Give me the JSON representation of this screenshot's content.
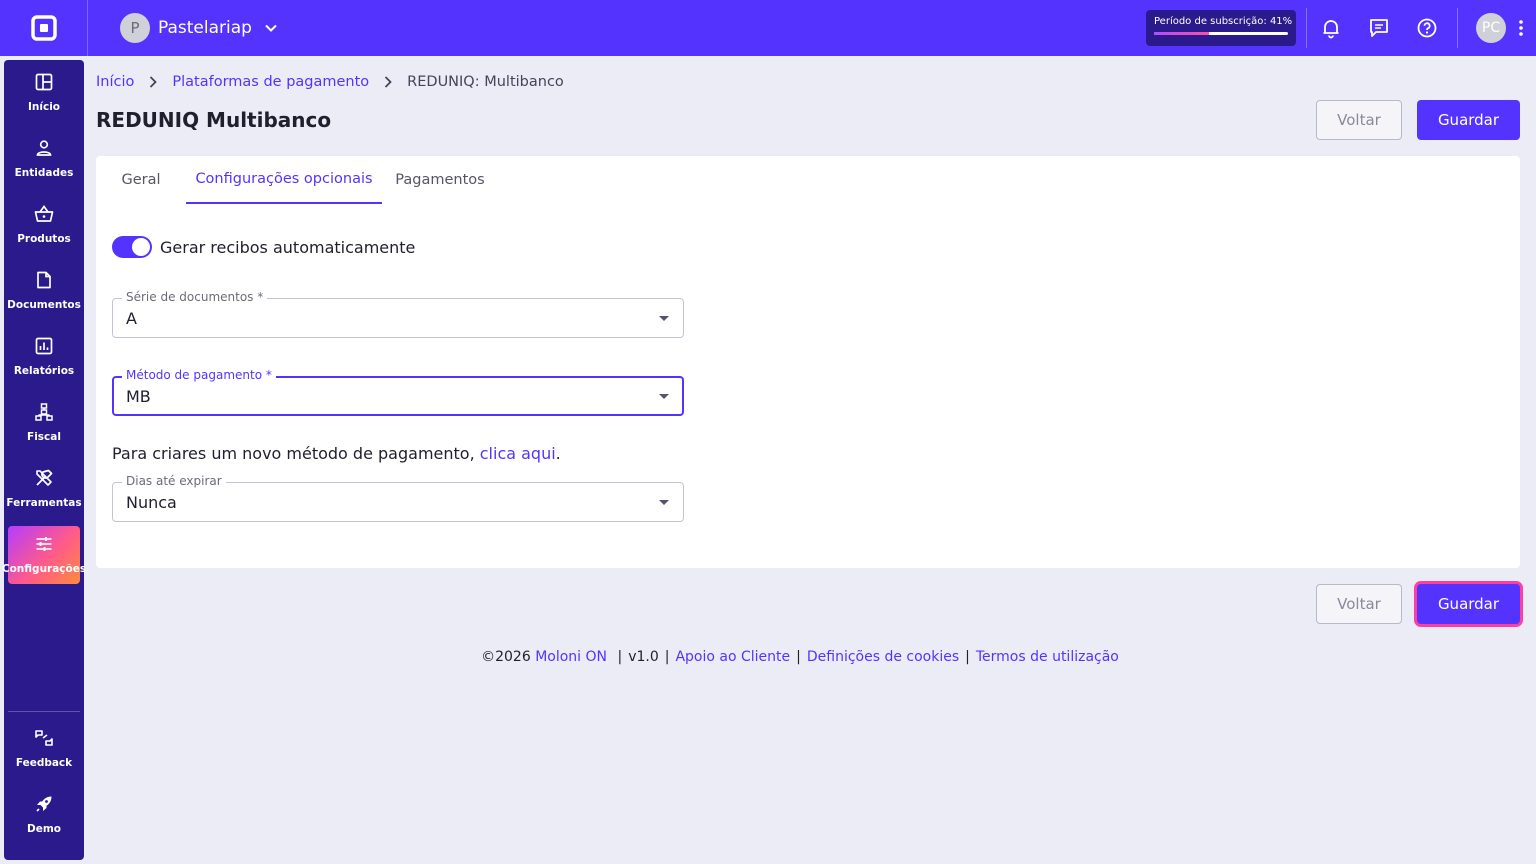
{
  "topbar": {
    "company_initial": "P",
    "company_name": "Pastelariap",
    "subscription_label": "Período de subscrição: 41%",
    "subscription_progress": 0.41,
    "user_initials": "PC",
    "icons": [
      "logo-icon",
      "chevron-down-icon",
      "bell-icon",
      "chat-icon",
      "help-icon",
      "kebab-icon"
    ]
  },
  "sidebar": {
    "items": [
      {
        "label": "Início",
        "icon": "dashboard-icon"
      },
      {
        "label": "Entidades",
        "icon": "person-icon"
      },
      {
        "label": "Produtos",
        "icon": "basket-icon"
      },
      {
        "label": "Documentos",
        "icon": "document-icon"
      },
      {
        "label": "Relatórios",
        "icon": "chart-icon"
      },
      {
        "label": "Fiscal",
        "icon": "hierarchy-icon"
      },
      {
        "label": "Ferramentas",
        "icon": "tools-icon"
      },
      {
        "label": "Configurações",
        "icon": "sliders-icon",
        "active": true
      }
    ],
    "bottom_items": [
      {
        "label": "Feedback",
        "icon": "feedback-icon"
      },
      {
        "label": "Demo",
        "icon": "rocket-icon"
      }
    ]
  },
  "breadcrumb": {
    "home": "Início",
    "section": "Plataformas de pagamento",
    "current": "REDUNIQ: Multibanco"
  },
  "page": {
    "title": "REDUNIQ Multibanco",
    "back_label": "Voltar",
    "save_label": "Guardar"
  },
  "tabs": [
    {
      "label": "Geral",
      "active": false
    },
    {
      "label": "Configurações opcionais",
      "active": true
    },
    {
      "label": "Pagamentos",
      "active": false
    }
  ],
  "form": {
    "auto_receipts_label": "Gerar recibos automaticamente",
    "auto_receipts_on": true,
    "document_series": {
      "label": "Série de documentos *",
      "value": "A"
    },
    "payment_method": {
      "label": "Método de pagamento *",
      "value": "MB"
    },
    "help_text": "Para criares um novo método de pagamento, ",
    "help_link": "clica aqui",
    "help_end": ".",
    "days_to_expire": {
      "label": "Dias até expirar",
      "value": "Nunca"
    }
  },
  "footer": {
    "copyright": "©2026",
    "brand": "Moloni ON",
    "version": "v1.0",
    "support": "Apoio ao Cliente",
    "cookies": "Definições de cookies",
    "terms": "Termos de utilização"
  },
  "colors": {
    "primary": "#5533ff",
    "sidebar": "#2a1a8c",
    "focus_ring": "#ff3fa0"
  }
}
